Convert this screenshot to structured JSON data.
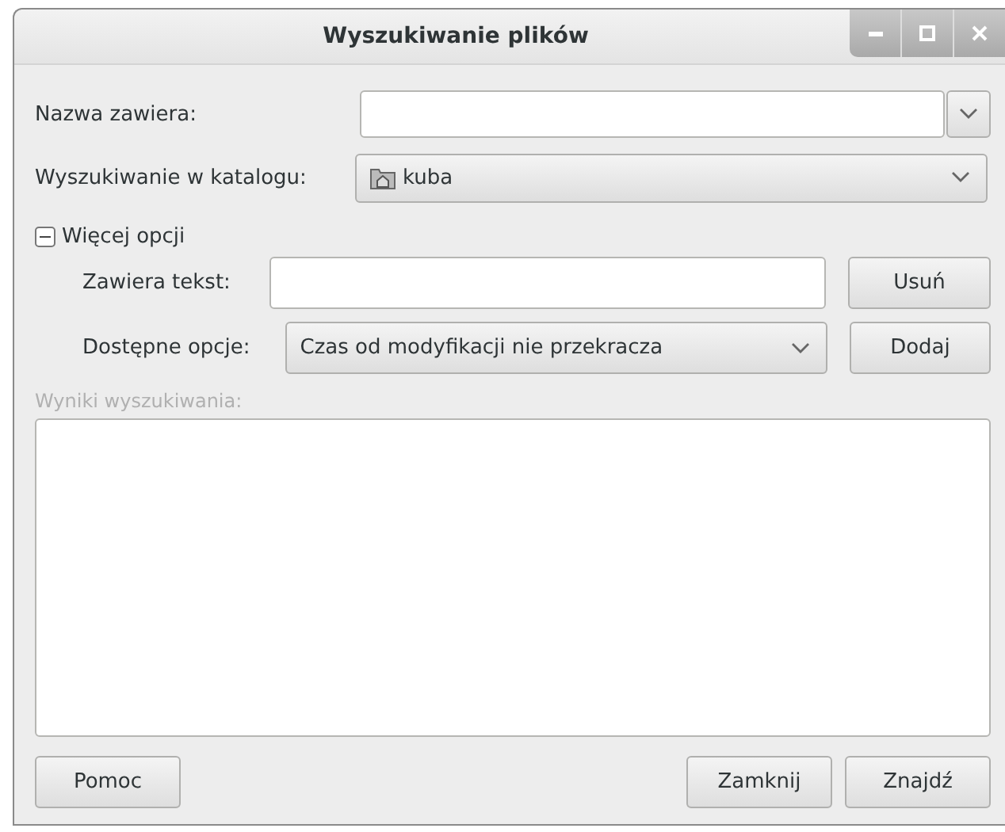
{
  "window": {
    "title": "Wyszukiwanie plików"
  },
  "name_field": {
    "label": "Nazwa zawiera:"
  },
  "folder": {
    "label": "Wyszukiwanie w katalogu:",
    "value": "kuba"
  },
  "more_options": {
    "label": "Więcej opcji",
    "expanded": true
  },
  "contains_text": {
    "label": "Zawiera tekst:",
    "button": "Usuń"
  },
  "available_options": {
    "label": "Dostępne opcje:",
    "value": "Czas od modyfikacji nie przekracza",
    "button": "Dodaj"
  },
  "results": {
    "label": "Wyniki wyszukiwania:",
    "disabled": true
  },
  "footer": {
    "left_buttons": [
      "Pomoc"
    ],
    "right_buttons": [
      "Zamknij",
      "Znajdź"
    ]
  }
}
